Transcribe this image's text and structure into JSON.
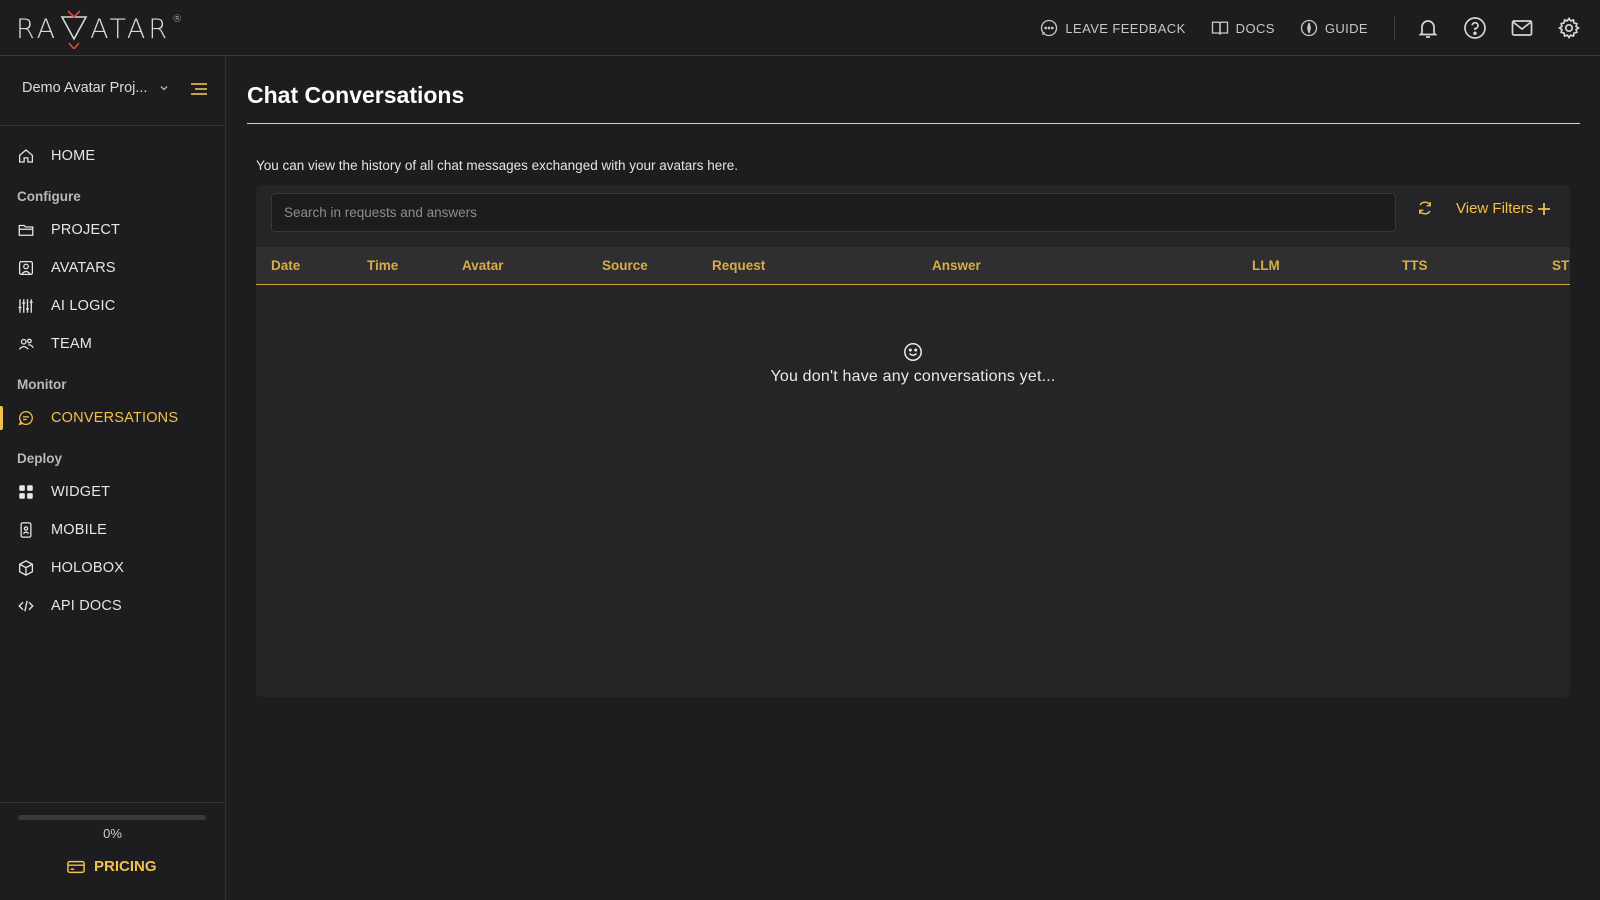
{
  "app": {
    "logo_text": "RAVATAR",
    "logo_reg": "®"
  },
  "header": {
    "links": [
      {
        "label": "LEAVE FEEDBACK",
        "icon": "feedback-icon"
      },
      {
        "label": "DOCS",
        "icon": "book-icon"
      },
      {
        "label": "GUIDE",
        "icon": "compass-icon"
      }
    ],
    "icons": [
      "bell-icon",
      "help-icon",
      "mail-icon",
      "settings-icon"
    ]
  },
  "sidebar": {
    "project_name": "Demo Avatar Proj...",
    "home_label": "HOME",
    "sections": {
      "configure": "Configure",
      "monitor": "Monitor",
      "deploy": "Deploy"
    },
    "items": {
      "home": "HOME",
      "project": "PROJECT",
      "avatars": "AVATARS",
      "ai_logic": "AI LOGIC",
      "team": "TEAM",
      "conversations": "CONVERSATIONS",
      "widget": "WIDGET",
      "mobile": "MOBILE",
      "holobox": "HOLOBOX",
      "api_docs": "API DOCS"
    },
    "active_item": "conversations",
    "progress_percent": 0,
    "progress_label": "0%",
    "pricing_label": "PRICING"
  },
  "main": {
    "title": "Chat Conversations",
    "description": "You can view the history of all chat messages exchanged with your avatars here.",
    "search_placeholder": "Search in requests and answers",
    "search_value": "",
    "view_filters_label": "View Filters",
    "columns": [
      "Date",
      "Time",
      "Avatar",
      "Source",
      "Request",
      "Answer",
      "LLM",
      "TTS",
      "ST"
    ],
    "empty_message": "You don't have any conversations yet..."
  },
  "colors": {
    "accent": "#f2c14a",
    "header_text": "#d9ac45",
    "background": "#1d1d1f",
    "panel": "#252527"
  }
}
